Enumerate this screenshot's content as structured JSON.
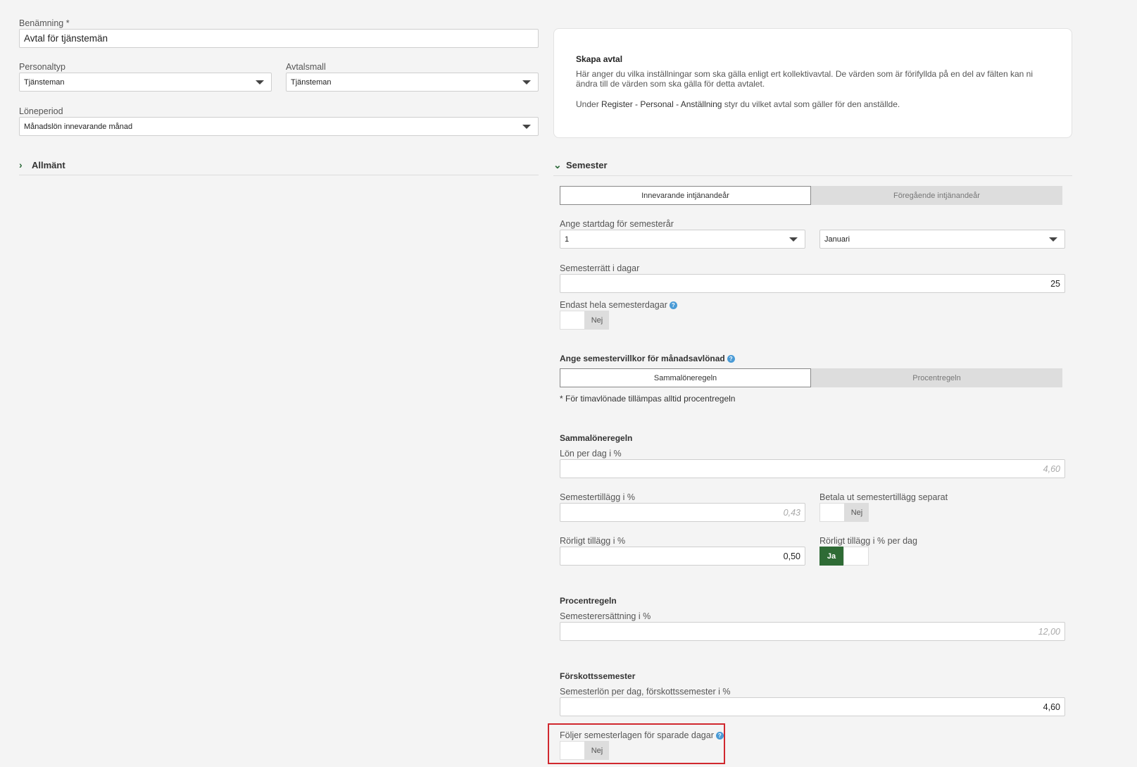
{
  "form": {
    "name_label": "Benämning *",
    "name_value": "Avtal för tjänstemän",
    "staff_type_label": "Personaltyp",
    "staff_type_value": "Tjänsteman",
    "template_label": "Avtalsmall",
    "template_value": "Tjänsteman",
    "pay_period_label": "Löneperiod",
    "pay_period_value": "Månadslön innevarande månad"
  },
  "info": {
    "title": "Skapa avtal",
    "text1": "Här anger du vilka inställningar som ska gälla enligt ert kollektivavtal. De värden som är förifyllda på en del av fälten kan ni ändra till de värden som ska gälla för detta avtalet.",
    "text2_pre": "Under ",
    "text2_path": "Register - Personal - Anställning",
    "text2_post": " styr du vilket avtal som gäller för den anställde."
  },
  "sections": {
    "general": "Allmänt",
    "vacation": "Semester"
  },
  "vacation": {
    "tab_current": "Innevarande intjänandeår",
    "tab_previous": "Föregående intjänandeår",
    "start_day_label": "Ange startdag för semesterår",
    "start_day_value": "1",
    "start_month_value": "Januari",
    "days_label": "Semesterrätt i dagar",
    "days_value": "25",
    "whole_days_label": "Endast hela semesterdagar",
    "whole_days_toggle": "Nej",
    "terms_label": "Ange semestervillkor för månadsavlönad",
    "rule_same": "Sammalöneregeln",
    "rule_percent": "Procentregeln",
    "hourly_note": "* För timavlönade tillämpas alltid procentregeln",
    "same_head": "Sammalöneregeln",
    "pay_per_day_label": "Lön per dag i %",
    "pay_per_day_placeholder": "4,60",
    "supplement_label": "Semestertillägg i %",
    "supplement_placeholder": "0,43",
    "pay_separate_label": "Betala ut semestertillägg separat",
    "pay_separate_toggle": "Nej",
    "variable_label": "Rörligt tillägg i %",
    "variable_value": "0,50",
    "variable_per_day_label": "Rörligt tillägg i % per dag",
    "variable_per_day_toggle": "Ja",
    "percent_head": "Procentregeln",
    "compensation_label": "Semesterersättning i %",
    "compensation_placeholder": "12,00",
    "advance_head": "Förskottssemester",
    "advance_label": "Semesterlön per dag, förskottssemester i %",
    "advance_value": "4,60",
    "saved_days_label": "Följer semesterlagen för sparade dagar",
    "saved_days_toggle": "Nej"
  },
  "colors": {
    "accent_green": "#2e6b35",
    "help_blue": "#4a9bd6",
    "highlight_red": "#d0282e"
  }
}
